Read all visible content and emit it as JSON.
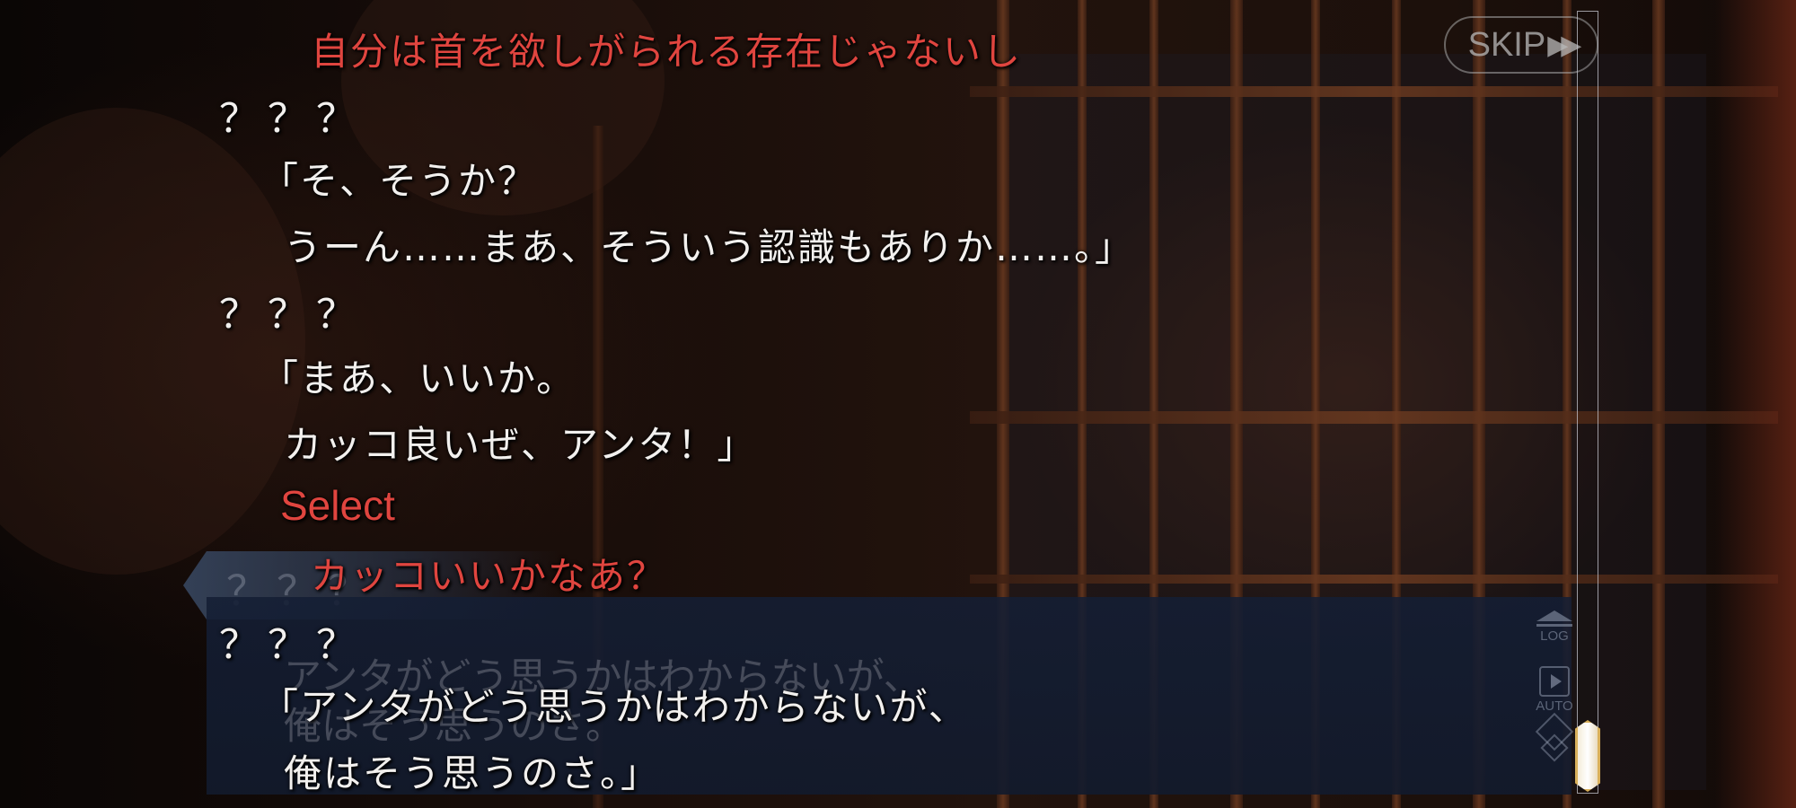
{
  "log": {
    "lines": [
      {
        "text": "自分は首を欲しがられる存在じゃないし",
        "kind": "choice"
      },
      {
        "text": "？？？",
        "kind": "speaker"
      },
      {
        "text": "「そ、そうか？",
        "kind": "dialogue"
      },
      {
        "text": "うーん……まあ、そういう認識もありか……。」",
        "kind": "dialogue"
      },
      {
        "text": "？？？",
        "kind": "speaker"
      },
      {
        "text": "「まあ、いいか。",
        "kind": "dialogue"
      },
      {
        "text": "カッコ良いぜ、アンタ！」",
        "kind": "dialogue"
      },
      {
        "text": "Select",
        "kind": "select"
      },
      {
        "text": "カッコいいかなあ？",
        "kind": "choice"
      },
      {
        "text": "？？？",
        "kind": "speaker"
      },
      {
        "text": "「アンタがどう思うかはわからないが、",
        "kind": "dialogue"
      },
      {
        "text": "俺はそう思うのさ。」",
        "kind": "dialogue"
      }
    ]
  },
  "message_box": {
    "speaker": "？？？",
    "text_line_1": "アンタがどう思うかはわからないが、",
    "text_line_2": "俺はそう思うのさ。"
  },
  "controls": {
    "skip_label": "SKIP",
    "skip_arrows": "▶▶",
    "log_label": "LOG",
    "auto_label": "AUTO"
  },
  "scroll": {
    "position": 1.0
  },
  "colors": {
    "choice_text": "#e0453f",
    "dialogue_text": "#f2f0ee",
    "message_box": "#14203a",
    "scroll_thumb_border": "#d9b05a"
  }
}
